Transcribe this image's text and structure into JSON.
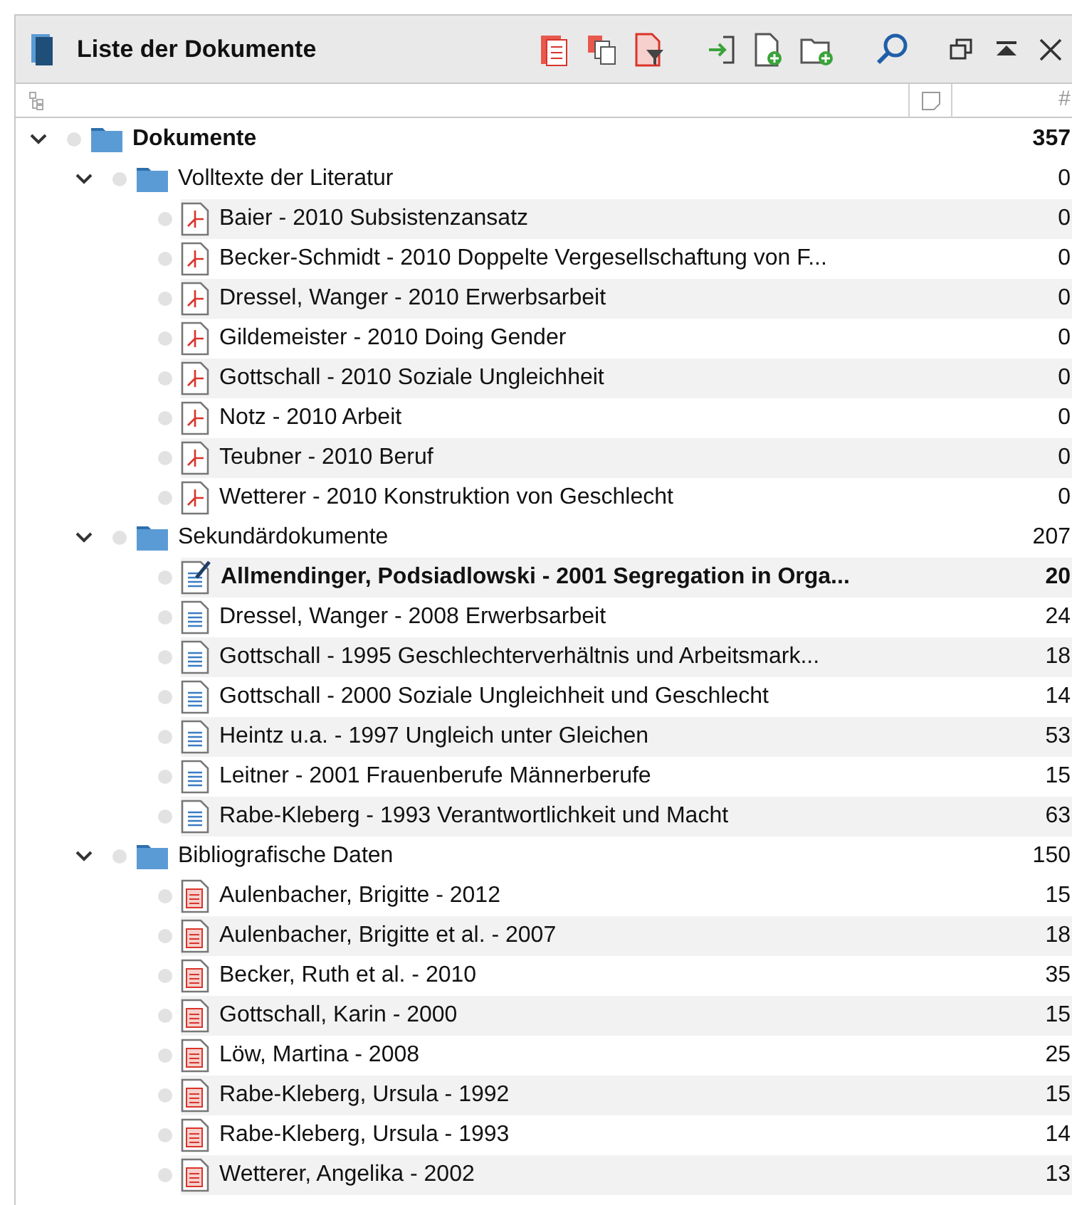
{
  "panel": {
    "title": "Liste der Dokumente"
  },
  "tree": [
    {
      "kind": "folder",
      "label": "Dokumente",
      "count": "357",
      "expanded": true,
      "bold": true,
      "children": [
        {
          "kind": "folder",
          "label": "Volltexte der Literatur",
          "count": "0",
          "expanded": true,
          "children": [
            {
              "kind": "pdf",
              "label": "Baier - 2010 Subsistenzansatz",
              "count": "0"
            },
            {
              "kind": "pdf",
              "label": "Becker-Schmidt - 2010 Doppelte Vergesellschaftung von F...",
              "count": "0"
            },
            {
              "kind": "pdf",
              "label": "Dressel, Wanger - 2010 Erwerbsarbeit",
              "count": "0"
            },
            {
              "kind": "pdf",
              "label": "Gildemeister - 2010 Doing Gender",
              "count": "0"
            },
            {
              "kind": "pdf",
              "label": "Gottschall - 2010 Soziale Ungleichheit",
              "count": "0"
            },
            {
              "kind": "pdf",
              "label": "Notz - 2010 Arbeit",
              "count": "0"
            },
            {
              "kind": "pdf",
              "label": "Teubner - 2010 Beruf",
              "count": "0"
            },
            {
              "kind": "pdf",
              "label": "Wetterer - 2010 Konstruktion von Geschlecht",
              "count": "0"
            }
          ]
        },
        {
          "kind": "folder",
          "label": "Sekundärdokumente",
          "count": "207",
          "expanded": true,
          "children": [
            {
              "kind": "text",
              "label": "Allmendinger, Podsiadlowski - 2001 Segregation in Orga...",
              "count": "20",
              "opened": true
            },
            {
              "kind": "text",
              "label": "Dressel, Wanger - 2008 Erwerbsarbeit",
              "count": "24",
              "opened": false
            },
            {
              "kind": "text",
              "label": "Gottschall - 1995 Geschlechterverhältnis und Arbeitsmark...",
              "count": "18",
              "opened": false
            },
            {
              "kind": "text",
              "label": "Gottschall - 2000 Soziale Ungleichheit und Geschlecht",
              "count": "14",
              "opened": false
            },
            {
              "kind": "text",
              "label": "Heintz u.a. - 1997 Ungleich unter Gleichen",
              "count": "53",
              "opened": false
            },
            {
              "kind": "text",
              "label": "Leitner - 2001 Frauenberufe Männerberufe",
              "count": "15",
              "opened": false
            },
            {
              "kind": "text",
              "label": "Rabe-Kleberg - 1993 Verantwortlichkeit und Macht",
              "count": "63",
              "opened": false
            }
          ]
        },
        {
          "kind": "folder",
          "label": "Bibliografische Daten",
          "count": "150",
          "expanded": true,
          "children": [
            {
              "kind": "biblio",
              "label": "Aulenbacher, Brigitte - 2012",
              "count": "15"
            },
            {
              "kind": "biblio",
              "label": "Aulenbacher, Brigitte et al. - 2007",
              "count": "18"
            },
            {
              "kind": "biblio",
              "label": "Becker, Ruth et al. - 2010",
              "count": "35"
            },
            {
              "kind": "biblio",
              "label": "Gottschall, Karin - 2000",
              "count": "15"
            },
            {
              "kind": "biblio",
              "label": "Löw, Martina - 2008",
              "count": "25"
            },
            {
              "kind": "biblio",
              "label": "Rabe-Kleberg, Ursula - 1992",
              "count": "15"
            },
            {
              "kind": "biblio",
              "label": "Rabe-Kleberg, Ursula - 1993",
              "count": "14"
            },
            {
              "kind": "biblio",
              "label": "Wetterer, Angelika - 2002",
              "count": "13"
            }
          ]
        }
      ]
    }
  ],
  "columns": {
    "column_3": "#"
  }
}
